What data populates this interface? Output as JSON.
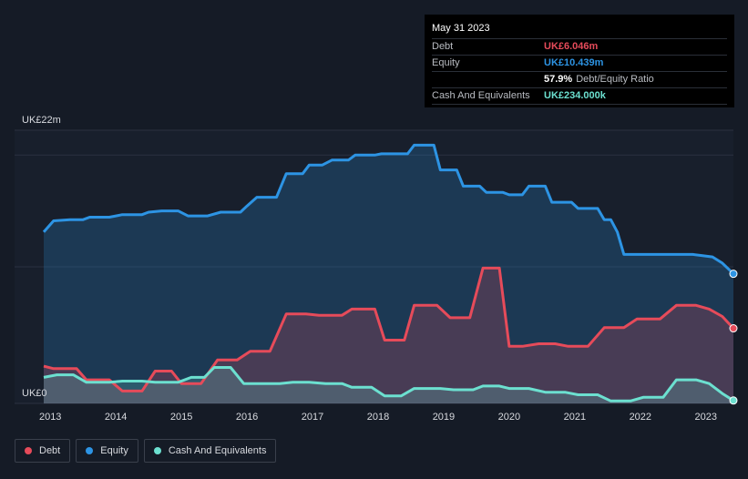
{
  "colors": {
    "debt": "#e64b5a",
    "equity": "#2d94e4",
    "cash": "#6ce0d0",
    "background": "#151b26",
    "plot_bg": "#181f2c"
  },
  "tooltip": {
    "date": "May 31 2023",
    "debt_label": "Debt",
    "debt_value": "UK£6.046m",
    "equity_label": "Equity",
    "equity_value": "UK£10.439m",
    "ratio_pct": "57.9%",
    "ratio_label": "Debt/Equity Ratio",
    "cash_label": "Cash And Equivalents",
    "cash_value": "UK£234.000k"
  },
  "legend": [
    {
      "key": "debt",
      "label": "Debt",
      "color": "#e64b5a"
    },
    {
      "key": "equity",
      "label": "Equity",
      "color": "#2d94e4"
    },
    {
      "key": "cash",
      "label": "Cash And Equivalents",
      "color": "#6ce0d0"
    }
  ],
  "chart_data": {
    "type": "area",
    "y_top_label": "UK£22m",
    "y_bottom_label": "UK£0",
    "ylim": [
      0,
      22
    ],
    "xlim": [
      2012.9,
      2023.42
    ],
    "x_ticks": [
      "2013",
      "2014",
      "2015",
      "2016",
      "2017",
      "2018",
      "2019",
      "2020",
      "2021",
      "2022",
      "2023"
    ],
    "series": [
      {
        "name": "Equity",
        "key": "equity",
        "points": [
          [
            2012.9,
            13.8
          ],
          [
            2013.05,
            14.7
          ],
          [
            2013.3,
            14.8
          ],
          [
            2013.5,
            14.8
          ],
          [
            2013.6,
            15.0
          ],
          [
            2013.9,
            15.0
          ],
          [
            2014.0,
            15.1
          ],
          [
            2014.1,
            15.2
          ],
          [
            2014.4,
            15.2
          ],
          [
            2014.5,
            15.4
          ],
          [
            2014.7,
            15.5
          ],
          [
            2014.95,
            15.5
          ],
          [
            2015.1,
            15.1
          ],
          [
            2015.4,
            15.1
          ],
          [
            2015.6,
            15.4
          ],
          [
            2015.9,
            15.4
          ],
          [
            2016.0,
            15.9
          ],
          [
            2016.15,
            16.6
          ],
          [
            2016.45,
            16.6
          ],
          [
            2016.6,
            18.5
          ],
          [
            2016.85,
            18.5
          ],
          [
            2016.95,
            19.2
          ],
          [
            2017.15,
            19.2
          ],
          [
            2017.3,
            19.6
          ],
          [
            2017.55,
            19.6
          ],
          [
            2017.65,
            20.0
          ],
          [
            2017.95,
            20.0
          ],
          [
            2018.05,
            20.1
          ],
          [
            2018.45,
            20.1
          ],
          [
            2018.55,
            20.8
          ],
          [
            2018.85,
            20.8
          ],
          [
            2018.95,
            18.8
          ],
          [
            2019.2,
            18.8
          ],
          [
            2019.3,
            17.5
          ],
          [
            2019.55,
            17.5
          ],
          [
            2019.65,
            17.0
          ],
          [
            2019.9,
            17.0
          ],
          [
            2020.0,
            16.8
          ],
          [
            2020.2,
            16.8
          ],
          [
            2020.3,
            17.5
          ],
          [
            2020.55,
            17.5
          ],
          [
            2020.65,
            16.2
          ],
          [
            2020.95,
            16.2
          ],
          [
            2021.05,
            15.7
          ],
          [
            2021.35,
            15.7
          ],
          [
            2021.45,
            14.8
          ],
          [
            2021.55,
            14.8
          ],
          [
            2021.65,
            13.8
          ],
          [
            2021.75,
            12.0
          ],
          [
            2022.0,
            12.0
          ],
          [
            2022.5,
            12.0
          ],
          [
            2022.8,
            12.0
          ],
          [
            2022.95,
            11.9
          ],
          [
            2023.1,
            11.8
          ],
          [
            2023.25,
            11.3
          ],
          [
            2023.42,
            10.439
          ]
        ]
      },
      {
        "name": "Debt",
        "key": "debt",
        "points": [
          [
            2012.9,
            3.0
          ],
          [
            2013.05,
            2.8
          ],
          [
            2013.4,
            2.8
          ],
          [
            2013.55,
            1.9
          ],
          [
            2013.9,
            1.9
          ],
          [
            2014.1,
            1.0
          ],
          [
            2014.4,
            1.0
          ],
          [
            2014.6,
            2.6
          ],
          [
            2014.85,
            2.6
          ],
          [
            2015.0,
            1.6
          ],
          [
            2015.3,
            1.6
          ],
          [
            2015.55,
            3.5
          ],
          [
            2015.85,
            3.5
          ],
          [
            2016.05,
            4.2
          ],
          [
            2016.35,
            4.2
          ],
          [
            2016.6,
            7.2
          ],
          [
            2016.9,
            7.2
          ],
          [
            2017.1,
            7.1
          ],
          [
            2017.45,
            7.1
          ],
          [
            2017.6,
            7.6
          ],
          [
            2017.95,
            7.6
          ],
          [
            2018.1,
            5.1
          ],
          [
            2018.4,
            5.1
          ],
          [
            2018.55,
            7.9
          ],
          [
            2018.9,
            7.9
          ],
          [
            2019.1,
            6.9
          ],
          [
            2019.4,
            6.9
          ],
          [
            2019.6,
            10.9
          ],
          [
            2019.85,
            10.9
          ],
          [
            2020.0,
            4.6
          ],
          [
            2020.2,
            4.6
          ],
          [
            2020.45,
            4.8
          ],
          [
            2020.7,
            4.8
          ],
          [
            2020.9,
            4.6
          ],
          [
            2021.2,
            4.6
          ],
          [
            2021.45,
            6.1
          ],
          [
            2021.75,
            6.1
          ],
          [
            2021.95,
            6.8
          ],
          [
            2022.3,
            6.8
          ],
          [
            2022.55,
            7.9
          ],
          [
            2022.85,
            7.9
          ],
          [
            2023.05,
            7.6
          ],
          [
            2023.25,
            7.0
          ],
          [
            2023.42,
            6.046
          ]
        ]
      },
      {
        "name": "Cash And Equivalents",
        "key": "cash",
        "points": [
          [
            2012.9,
            2.1
          ],
          [
            2013.1,
            2.3
          ],
          [
            2013.35,
            2.3
          ],
          [
            2013.55,
            1.7
          ],
          [
            2013.9,
            1.7
          ],
          [
            2014.1,
            1.8
          ],
          [
            2014.4,
            1.8
          ],
          [
            2014.6,
            1.7
          ],
          [
            2014.95,
            1.7
          ],
          [
            2015.15,
            2.1
          ],
          [
            2015.35,
            2.1
          ],
          [
            2015.5,
            2.9
          ],
          [
            2015.75,
            2.9
          ],
          [
            2015.95,
            1.6
          ],
          [
            2016.2,
            1.6
          ],
          [
            2016.5,
            1.6
          ],
          [
            2016.7,
            1.7
          ],
          [
            2016.95,
            1.7
          ],
          [
            2017.2,
            1.6
          ],
          [
            2017.45,
            1.6
          ],
          [
            2017.6,
            1.3
          ],
          [
            2017.9,
            1.3
          ],
          [
            2018.1,
            0.6
          ],
          [
            2018.35,
            0.6
          ],
          [
            2018.55,
            1.2
          ],
          [
            2018.95,
            1.2
          ],
          [
            2019.15,
            1.1
          ],
          [
            2019.45,
            1.1
          ],
          [
            2019.6,
            1.4
          ],
          [
            2019.85,
            1.4
          ],
          [
            2020.0,
            1.2
          ],
          [
            2020.3,
            1.2
          ],
          [
            2020.55,
            0.9
          ],
          [
            2020.85,
            0.9
          ],
          [
            2021.05,
            0.7
          ],
          [
            2021.35,
            0.7
          ],
          [
            2021.55,
            0.2
          ],
          [
            2021.85,
            0.2
          ],
          [
            2022.05,
            0.5
          ],
          [
            2022.35,
            0.5
          ],
          [
            2022.55,
            1.9
          ],
          [
            2022.85,
            1.9
          ],
          [
            2023.05,
            1.6
          ],
          [
            2023.25,
            0.8
          ],
          [
            2023.42,
            0.234
          ]
        ]
      }
    ]
  }
}
